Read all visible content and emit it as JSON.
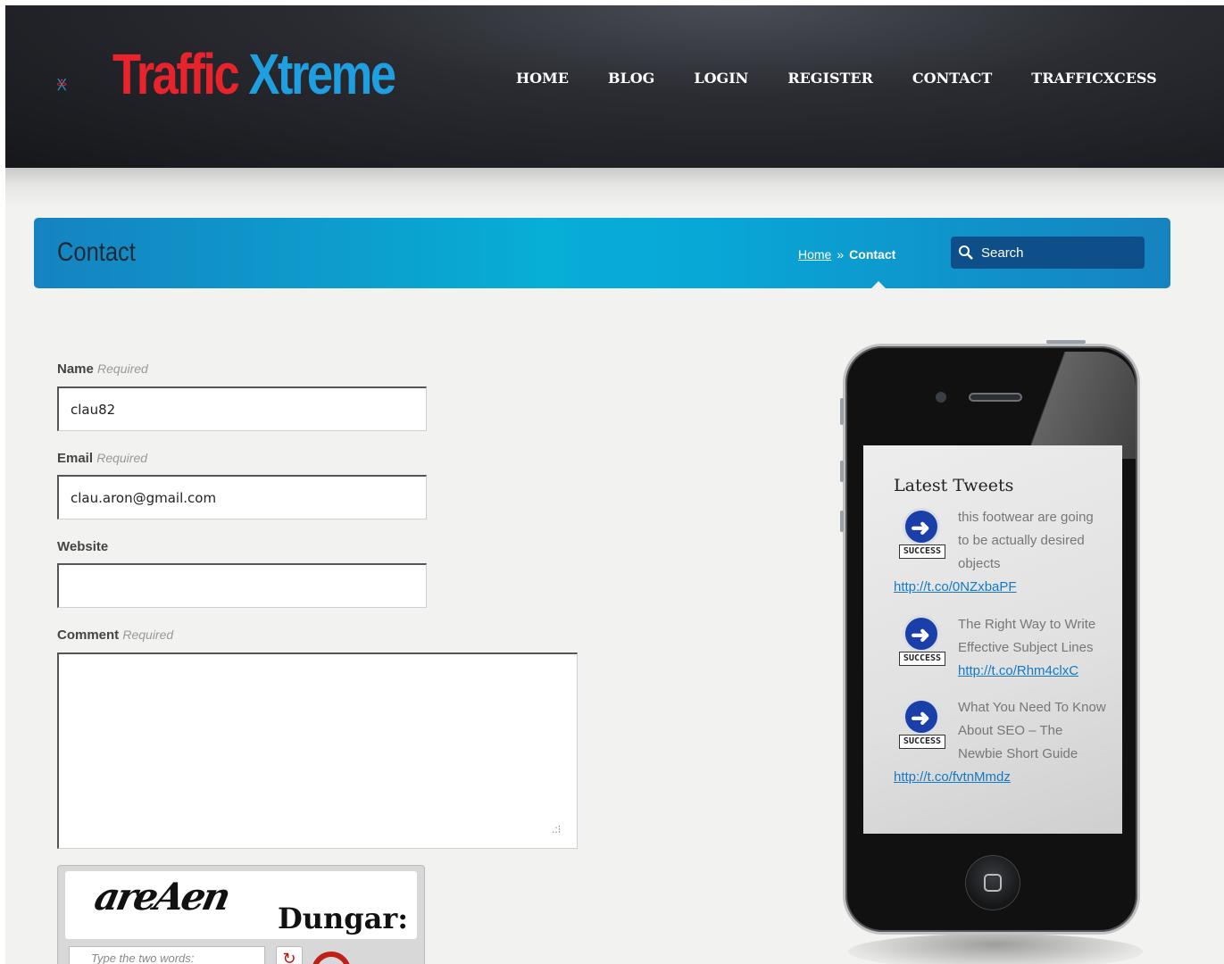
{
  "site": {
    "logo_word1": "Traffic",
    "logo_word2": "Xtreme",
    "nav": [
      "HOME",
      "BLOG",
      "LOGIN",
      "REGISTER",
      "CONTACT",
      "TRAFFICXCESS"
    ]
  },
  "title_bar": {
    "page_title": "Contact",
    "breadcrumb_home": "Home",
    "breadcrumb_sep": "»",
    "breadcrumb_current": "Contact",
    "search_placeholder": "Search"
  },
  "form": {
    "name_label": "Name",
    "name_required": "Required",
    "name_value": "clau82",
    "email_label": "Email",
    "email_required": "Required",
    "email_value": "clau.aron@gmail.com",
    "website_label": "Website",
    "website_value": "",
    "comment_label": "Comment",
    "comment_required": "Required",
    "comment_value": ""
  },
  "captcha": {
    "word1": "areAen",
    "word2": "Dungar:",
    "input_placeholder": "Type the two words:"
  },
  "tweets": {
    "title": "Latest Tweets",
    "badge": "SUCCESS",
    "items": [
      {
        "text": "this footwear are going to be actually desired objects ",
        "link": "http://t.co/0NZxbaPF"
      },
      {
        "text": "The Right Way to Write Effective Subject Lines ",
        "link": "http://t.co/Rhm4clxC"
      },
      {
        "text": "What You Need To Know About SEO – The Newbie Short Guide ",
        "link": "http://t.co/fvtnMmdz"
      }
    ]
  },
  "colors": {
    "logo_red": "#e8232b",
    "logo_blue": "#1f9fe0",
    "title_bar": "#07aed6",
    "link": "#1479c4"
  }
}
